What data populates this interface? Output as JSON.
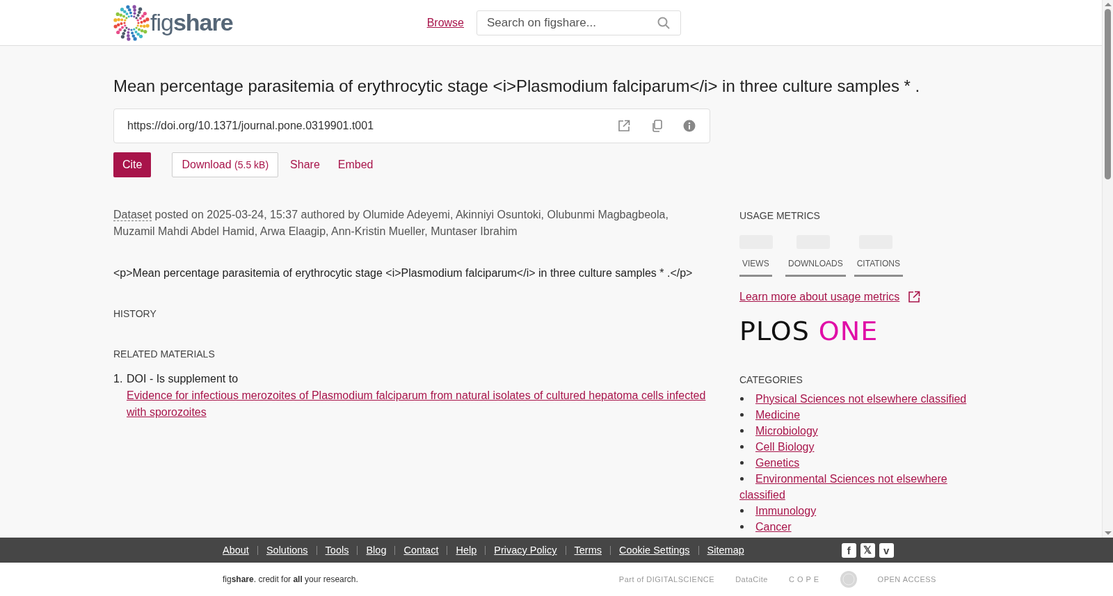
{
  "header": {
    "logo": "fig**share**",
    "nav_link": "Browse",
    "search": {
      "placeholder": "Search on figshare..."
    }
  },
  "title": "Mean percentage parasitemia of erythrocytic stage <i>Plasmodium falciparum</i> in three culture samples * .",
  "doi": "https://doi.org/10.1371/journal.pone.0319901.t001",
  "actions": [
    {
      "kind": "primary",
      "label": "Cite"
    },
    {
      "kind": "outline",
      "label": "Download",
      "note": "(5.5 kB)"
    },
    {
      "kind": "link",
      "label": "Share"
    },
    {
      "kind": "link",
      "label": "Embed"
    }
  ],
  "item_type": "Dataset",
  "byline": "posted on 2025-03-24, 15:37 authored by Olumide Adeyemi, Akinniyi Osuntoki, Olubunmi Magbagbeola, Muzamil Mahdi Abdel Hamid, Arwa Elaagip, Ann-Kristin Mueller, Muntaser Ibrahim",
  "description": "<p>Mean percentage parasitemia of erythrocytic stage <i>Plasmodium falciparum</i> in three culture samples * .</p>",
  "history_heading": "HISTORY",
  "related_heading": "RELATED MATERIALS",
  "related": [
    {
      "number": "1.",
      "relation": "DOI - Is supplement to",
      "link": "Evidence for infectious merozoites of Plasmodium falciparum from natural isolates of cultured hepatoma cells infected with sporozoites"
    }
  ],
  "metrics": {
    "heading": "USAGE METRICS",
    "tabs": [
      "VIEWS",
      "DOWNLOADS",
      "CITATIONS"
    ],
    "learn_more": "Learn more about usage metrics"
  },
  "publisher_logo": {
    "first": "PLOS",
    "second": "ONE"
  },
  "categories": {
    "heading": "CATEGORIES",
    "items": [
      "Physical Sciences not elsewhere classified",
      "Medicine",
      "Microbiology",
      "Cell Biology",
      "Genetics",
      "Environmental Sciences not elsewhere classified",
      "Immunology",
      "Cancer"
    ]
  },
  "footer": {
    "links": [
      "About",
      "Solutions",
      "Tools",
      "Blog",
      "Contact",
      "Help",
      "Privacy Policy",
      "Terms",
      "Cookie Settings",
      "Sitemap"
    ],
    "social": [
      "f",
      "𝕏",
      "v"
    ],
    "tagline": "fig**share**. credit for **all** your research.",
    "partners": [
      {
        "kind": "text",
        "label": "Part of DIGITALSCIENCE"
      },
      {
        "kind": "text",
        "label": "DataCite"
      },
      {
        "kind": "text",
        "label": "C O P E"
      },
      {
        "kind": "seal"
      },
      {
        "kind": "text",
        "label": "OPEN ACCESS"
      }
    ]
  }
}
